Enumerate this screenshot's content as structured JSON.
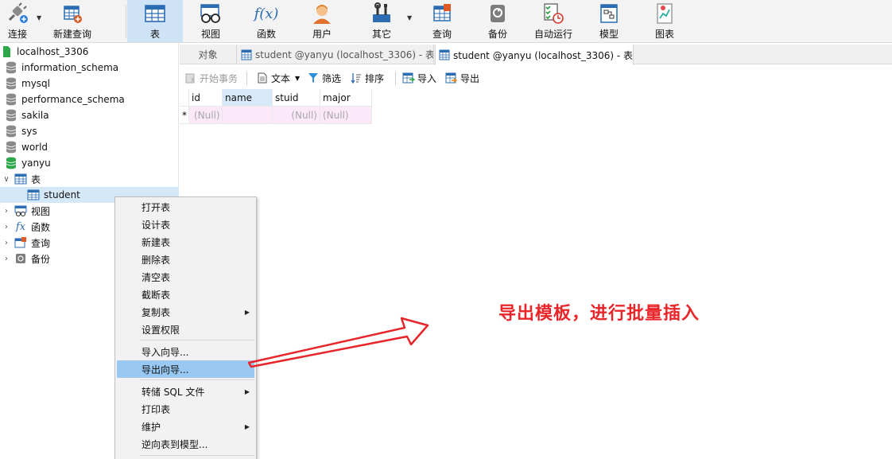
{
  "toolbar": {
    "connect": "连接",
    "new_query": "新建查询",
    "table": "表",
    "view": "视图",
    "function": "函数",
    "user": "用户",
    "other": "其它",
    "query": "查询",
    "backup": "备份",
    "automation": "自动运行",
    "model": "模型",
    "chart": "图表",
    "fx_glyph": "f(x)"
  },
  "sidebar": {
    "connection": "localhost_3306",
    "databases": [
      "information_schema",
      "mysql",
      "performance_schema",
      "sakila",
      "sys",
      "world",
      "yanyu"
    ],
    "tables_node": "表",
    "selected_table": "student",
    "view_node": "视图",
    "function_node": "函数",
    "query_node": "查询",
    "backup_node": "备份"
  },
  "tabs": [
    {
      "label": "对象"
    },
    {
      "label": "student @yanyu (localhost_3306) - 表"
    },
    {
      "label": "student @yanyu (localhost_3306) - 表"
    }
  ],
  "table_toolbar": {
    "begin_transaction": "开始事务",
    "text": "文本",
    "filter": "筛选",
    "sort": "排序",
    "import": "导入",
    "export": "导出"
  },
  "grid": {
    "columns": [
      "id",
      "name",
      "stuid",
      "major"
    ],
    "new_row_marker": "*",
    "null_text": "(Null)"
  },
  "context_menu": {
    "items": [
      "打开表",
      "设计表",
      "新建表",
      "删除表",
      "清空表",
      "截断表",
      "复制表",
      "设置权限",
      "导入向导...",
      "导出向导...",
      "转储 SQL 文件",
      "打印表",
      "维护",
      "逆向表到模型..."
    ],
    "highlighted": "导出向导..."
  },
  "annotation": {
    "text": "导出模板，进行批量插入",
    "color": "#e8262a"
  },
  "colors": {
    "accent_selected": "#cfe3f7",
    "menu_highlight": "#99c9f3",
    "new_row_bg": "#fbe8f8"
  }
}
